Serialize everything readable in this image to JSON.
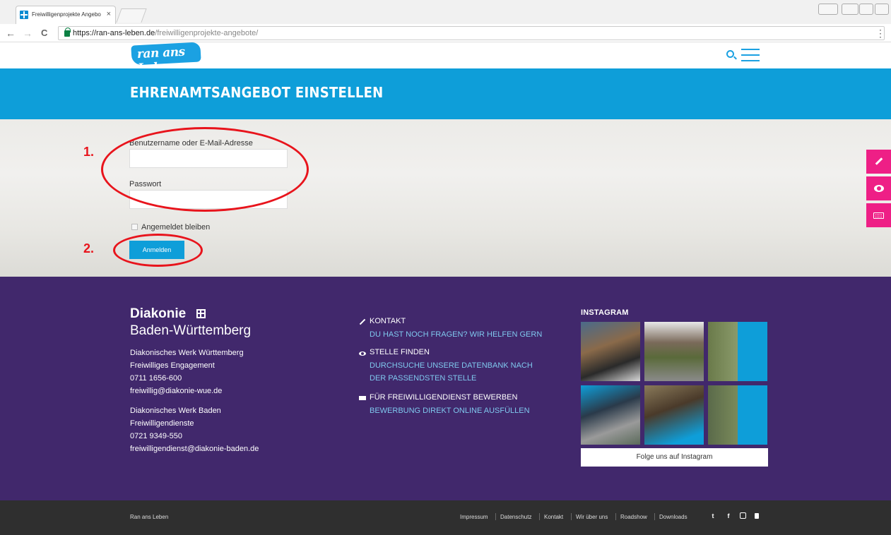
{
  "browser": {
    "tab_title": "Freiwilligenprojekte Angebo",
    "tab_close": "×",
    "url_host": "https://ran-ans-leben.de",
    "url_path": "/freiwilligenprojekte-angebote/",
    "nav_back": "←",
    "nav_forward": "→",
    "nav_reload": "C",
    "menu": "⋮"
  },
  "header": {
    "logo_text": "ran ans Leben"
  },
  "title_band": {
    "title": "EHRENAMTSANGEBOT EINSTELLEN"
  },
  "login": {
    "username_label": "Benutzername oder E-Mail-Adresse",
    "username_value": "",
    "password_label": "Passwort",
    "password_value": "",
    "remember_label": "Angemeldet bleiben",
    "submit_label": "Anmelden"
  },
  "annotations": {
    "first": "1.",
    "second": "2."
  },
  "side_toolbar": {
    "items": [
      "pencil-icon",
      "eye-icon",
      "keyboard-icon"
    ],
    "color": "#ee1f86"
  },
  "footer": {
    "brand": {
      "name": "Diakonie",
      "region": "Baden-Württemberg"
    },
    "wue": {
      "org": "Diakonisches Werk Württemberg",
      "dept": "Freiwilliges Engagement",
      "phone": "0711 1656-600",
      "email": "freiwillig@diakonie-wue.de"
    },
    "baden": {
      "org": "Diakonisches Werk Baden",
      "dept": "Freiwilligendienste",
      "phone": "0721 9349-550",
      "email": "freiwilligendienst@diakonie-baden.de"
    },
    "links": [
      {
        "icon": "pencil-icon",
        "heading": "KONTAKT",
        "sub": "DU HAST NOCH FRAGEN? WIR HELFEN GERN",
        "sub2": ""
      },
      {
        "icon": "eye-icon",
        "heading": "STELLE FINDEN",
        "sub": "DURCHSUCHE UNSERE DATENBANK NACH",
        "sub2": "DER PASSENDSTEN STELLE"
      },
      {
        "icon": "keyboard-icon",
        "heading": "FÜR FREIWILLIGENDIENST BEWERBEN",
        "sub": "BEWERBUNG DIREKT ONLINE AUSFÜLLEN",
        "sub2": ""
      }
    ],
    "instagram": {
      "heading": "INSTAGRAM",
      "follow": "Folge uns auf Instagram"
    }
  },
  "bottombar": {
    "site": "Ran ans Leben",
    "links": [
      "Impressum",
      "Datenschutz",
      "Kontakt",
      "Wir über uns",
      "Roadshow",
      "Downloads"
    ],
    "social": [
      "twitter-icon",
      "facebook-icon",
      "instagram-icon",
      "youtube-icon"
    ]
  },
  "colors": {
    "accent_blue": "#0e9ed9",
    "footer_purple": "#41286c",
    "annotation_red": "#e8141c",
    "link_blue": "#7fc8ee"
  }
}
